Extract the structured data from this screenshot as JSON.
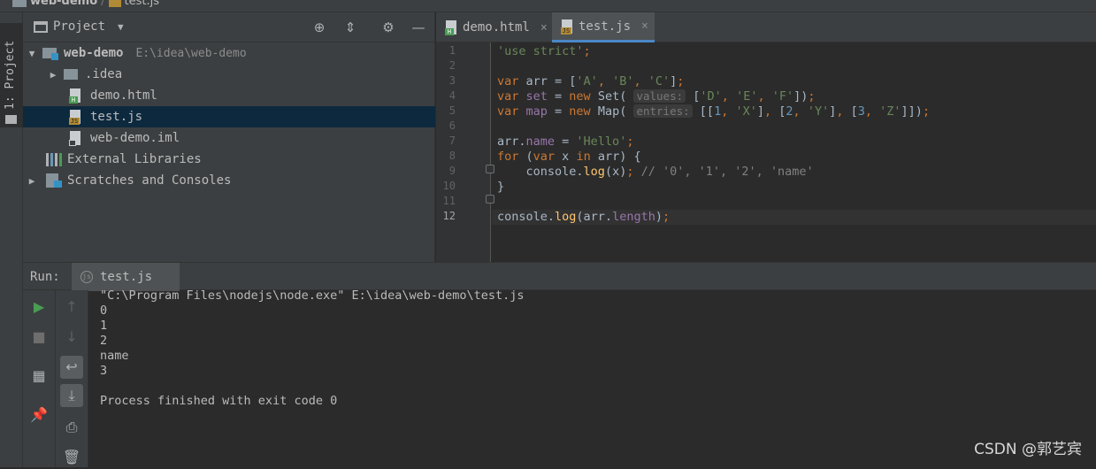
{
  "breadcrumb": {
    "project": "web-demo",
    "file": "test.js"
  },
  "side_tab": {
    "label": "1: Project"
  },
  "project_panel": {
    "title": "Project",
    "tree": [
      {
        "name": "web-demo",
        "path": "E:\\idea\\web-demo",
        "type": "module-folder",
        "expanded": true
      },
      {
        "name": ".idea",
        "type": "folder",
        "expanded": false
      },
      {
        "name": "demo.html",
        "type": "html-file"
      },
      {
        "name": "test.js",
        "type": "js-file",
        "selected": true
      },
      {
        "name": "web-demo.iml",
        "type": "iml-file"
      },
      {
        "name": "External Libraries",
        "type": "libraries"
      },
      {
        "name": "Scratches and Consoles",
        "type": "scratches",
        "expanded": false
      }
    ]
  },
  "editor": {
    "tabs": [
      {
        "label": "demo.html",
        "close": "×",
        "active": false
      },
      {
        "label": "test.js",
        "close": "×",
        "active": true
      }
    ],
    "line_numbers": [
      "1",
      "2",
      "3",
      "4",
      "5",
      "6",
      "7",
      "8",
      "9",
      "10",
      "11",
      "12"
    ],
    "current_line": "12",
    "hints": {
      "values": "values:",
      "entries": "entries:"
    }
  },
  "run_panel": {
    "label": "Run:",
    "tab": "test.js",
    "output": [
      "\"C:\\Program Files\\nodejs\\node.exe\" E:\\idea\\web-demo\\test.js",
      "0",
      "1",
      "2",
      "name",
      "3",
      "",
      "Process finished with exit code 0"
    ]
  },
  "watermark": "CSDN @郭艺宾",
  "colors": {
    "selection": "#0d293e",
    "keyword": "#cc7832",
    "string": "#6a8759",
    "number": "#6897bb",
    "property": "#9876aa",
    "function": "#ffc66d",
    "run_green": "#499c54"
  }
}
